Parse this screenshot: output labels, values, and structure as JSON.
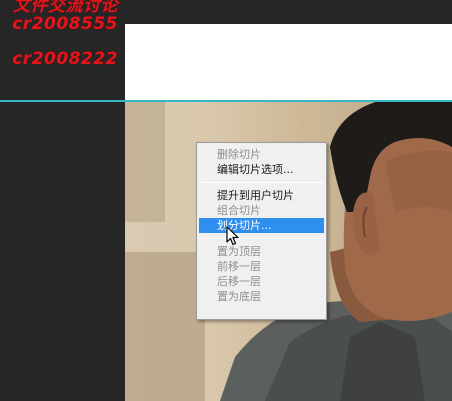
{
  "watermark": {
    "lines": [
      "文件交流讨论",
      "cr2008555",
      "cr2008222"
    ]
  },
  "colors": {
    "guide": "#38b6c8",
    "watermark": "#e3141b",
    "highlight": "#2f8fef"
  },
  "context_menu": {
    "groups": [
      [
        {
          "label": "删除切片",
          "enabled": false
        },
        {
          "label": "编辑切片选项...",
          "enabled": true
        }
      ],
      [
        {
          "label": "提升到用户切片",
          "enabled": true
        },
        {
          "label": "组合切片",
          "enabled": false
        },
        {
          "label": "划分切片...",
          "enabled": true,
          "highlighted": true
        }
      ],
      [
        {
          "label": "置为顶层",
          "enabled": false
        },
        {
          "label": "前移一层",
          "enabled": false
        },
        {
          "label": "后移一层",
          "enabled": false
        },
        {
          "label": "置为底层",
          "enabled": false
        }
      ]
    ]
  },
  "cursor": {
    "icon": "arrow-pointer-icon"
  }
}
